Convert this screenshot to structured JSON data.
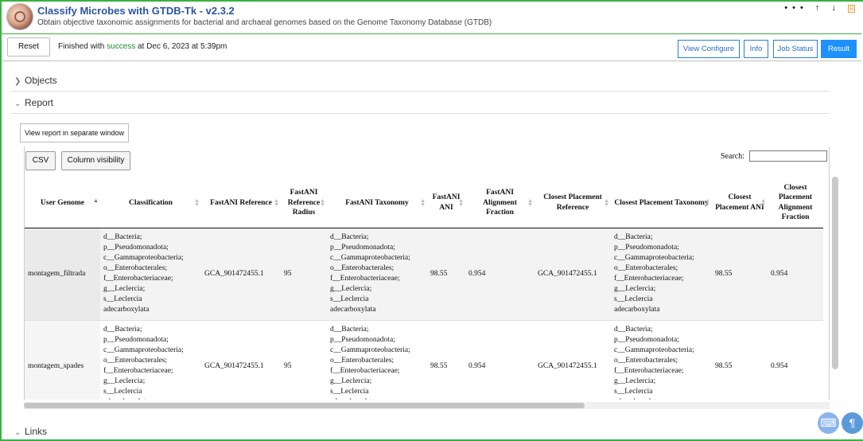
{
  "header": {
    "title": "Classify Microbes with GTDB-Tk - v2.3.2",
    "subtitle": "Obtain objective taxonomic assignments for bacterial and archaeal genomes based on the Genome Taxonomy Database (GTDB)",
    "controls": [
      "•••",
      "↑",
      "↓",
      "⊟"
    ]
  },
  "toolbar": {
    "reset_label": "Reset",
    "status_prefix": "Finished with",
    "status_word": "success",
    "status_suffix": "at Dec 6, 2023 at 5:39pm",
    "tabs": [
      "View Configure",
      "Info",
      "Job Status",
      "Result"
    ],
    "active_tab": "Result"
  },
  "sections": {
    "objects": "Objects",
    "report": "Report",
    "links": "Links"
  },
  "report": {
    "separate_window_label": "View report in separate window",
    "csv_label": "CSV",
    "column_visibility_label": "Column visibility",
    "search_label": "Search:",
    "search_value": "",
    "columns": [
      "User Genome",
      "Classification",
      "FastANI Reference",
      "FastANI Reference Radius",
      "FastANI Taxonomy",
      "FastANI ANI",
      "FastANI Alignment Fraction",
      "Closest Placement Reference",
      "Closest Placement Taxonomy",
      "Closest Placement ANI",
      "Closest Placement Alignment Fraction"
    ],
    "sorted_column": "User Genome",
    "rows": [
      {
        "genome": "montagem_filtrada",
        "classification": [
          "d__Bacteria;",
          "p__Pseudomonadota;",
          "c__Gammaproteobacteria;",
          "o__Enterobacterales;",
          "f__Enterobacteriaceae;",
          "g__Leclercia;",
          "s__Leclercia",
          "adecarboxylata"
        ],
        "fastani_ref": "GCA_901472455.1",
        "fastani_radius": "95",
        "fastani_taxonomy": [
          "d__Bacteria;",
          "p__Pseudomonadota;",
          "c__Gammaproteobacteria;",
          "o__Enterobacterales;",
          "f__Enterobacteriaceae;",
          "g__Leclercia;",
          "s__Leclercia",
          "adecarboxylata"
        ],
        "fastani_ani": "98.55",
        "fastani_af": "0.954",
        "closest_ref": "GCA_901472455.1",
        "closest_taxonomy": [
          "d__Bacteria;",
          "p__Pseudomonadota;",
          "c__Gammaproteobacteria;",
          "o__Enterobacterales;",
          "f__Enterobacteriaceae;",
          "g__Leclercia;",
          "s__Leclercia",
          "adecarboxylata"
        ],
        "closest_ani": "98.55",
        "closest_af": "0.954"
      },
      {
        "genome": "montagem_spades",
        "classification": [
          "d__Bacteria;",
          "p__Pseudomonadota;",
          "c__Gammaproteobacteria;",
          "o__Enterobacterales;",
          "f__Enterobacteriaceae;",
          "g__Leclercia;",
          "s__Leclercia",
          "adecarboxylata"
        ],
        "fastani_ref": "GCA_901472455.1",
        "fastani_radius": "95",
        "fastani_taxonomy": [
          "d__Bacteria;",
          "p__Pseudomonadota;",
          "c__Gammaproteobacteria;",
          "o__Enterobacterales;",
          "f__Enterobacteriaceae;",
          "g__Leclercia;",
          "s__Leclercia",
          "adecarboxylata"
        ],
        "fastani_ani": "98.55",
        "fastani_af": "0.954",
        "closest_ref": "GCA_901472455.1",
        "closest_taxonomy": [
          "d__Bacteria;",
          "p__Pseudomonadota;",
          "c__Gammaproteobacteria;",
          "o__Enterobacterales;",
          "f__Enterobacteriaceae;",
          "g__Leclercia;",
          "s__Leclercia",
          "adecarboxylata"
        ],
        "closest_ani": "98.55",
        "closest_af": "0.954"
      }
    ]
  },
  "colors": {
    "frame_border": "#3cb043",
    "title": "#2a55a3",
    "accent": "#1e90ff",
    "success": "#1b8a2e"
  },
  "icons": {
    "more": "more-icon",
    "up": "arrow-up-icon",
    "down": "arrow-down-icon",
    "collapse": "collapse-icon",
    "terminal": "terminal-icon",
    "paragraph": "paragraph-icon"
  },
  "fab": {
    "terminal_glyph": "⌨",
    "paragraph_glyph": "¶"
  }
}
